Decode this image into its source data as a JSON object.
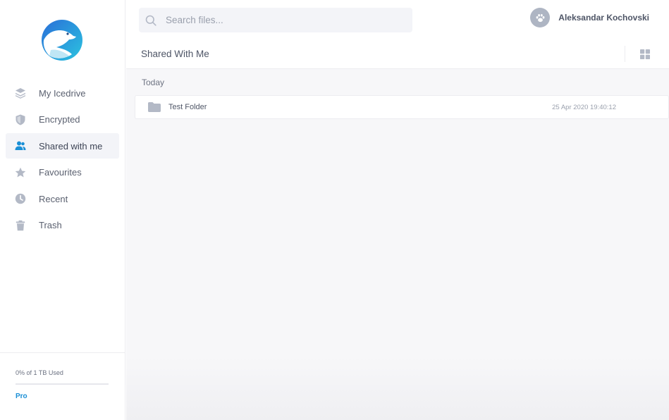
{
  "app": {
    "logo_icon": "polar-bear-logo-icon",
    "accent_color": "#1a8fd6"
  },
  "sidebar": {
    "items": [
      {
        "label": "My Icedrive",
        "icon": "layers-icon",
        "active": false
      },
      {
        "label": "Encrypted",
        "icon": "shield-icon",
        "active": false
      },
      {
        "label": "Shared with me",
        "icon": "users-icon",
        "active": true
      },
      {
        "label": "Favourites",
        "icon": "star-icon",
        "active": false
      },
      {
        "label": "Recent",
        "icon": "clock-icon",
        "active": false
      },
      {
        "label": "Trash",
        "icon": "trash-icon",
        "active": false
      }
    ],
    "storage": {
      "text": "0% of 1 TB Used",
      "used_fraction": 0,
      "plan_link": "Pro"
    }
  },
  "header": {
    "search": {
      "placeholder": "Search files...",
      "value": "",
      "icon": "search-icon"
    },
    "user": {
      "name": "Aleksandar Kochovski",
      "avatar_icon": "paw-icon"
    }
  },
  "page": {
    "title": "Shared With Me",
    "view_toggle_icon": "grid-view-icon"
  },
  "files": {
    "groups": [
      {
        "label": "Today",
        "items": [
          {
            "name": "Test Folder",
            "icon": "folder-icon",
            "date": "25 Apr 2020 19:40:12"
          }
        ]
      }
    ]
  }
}
